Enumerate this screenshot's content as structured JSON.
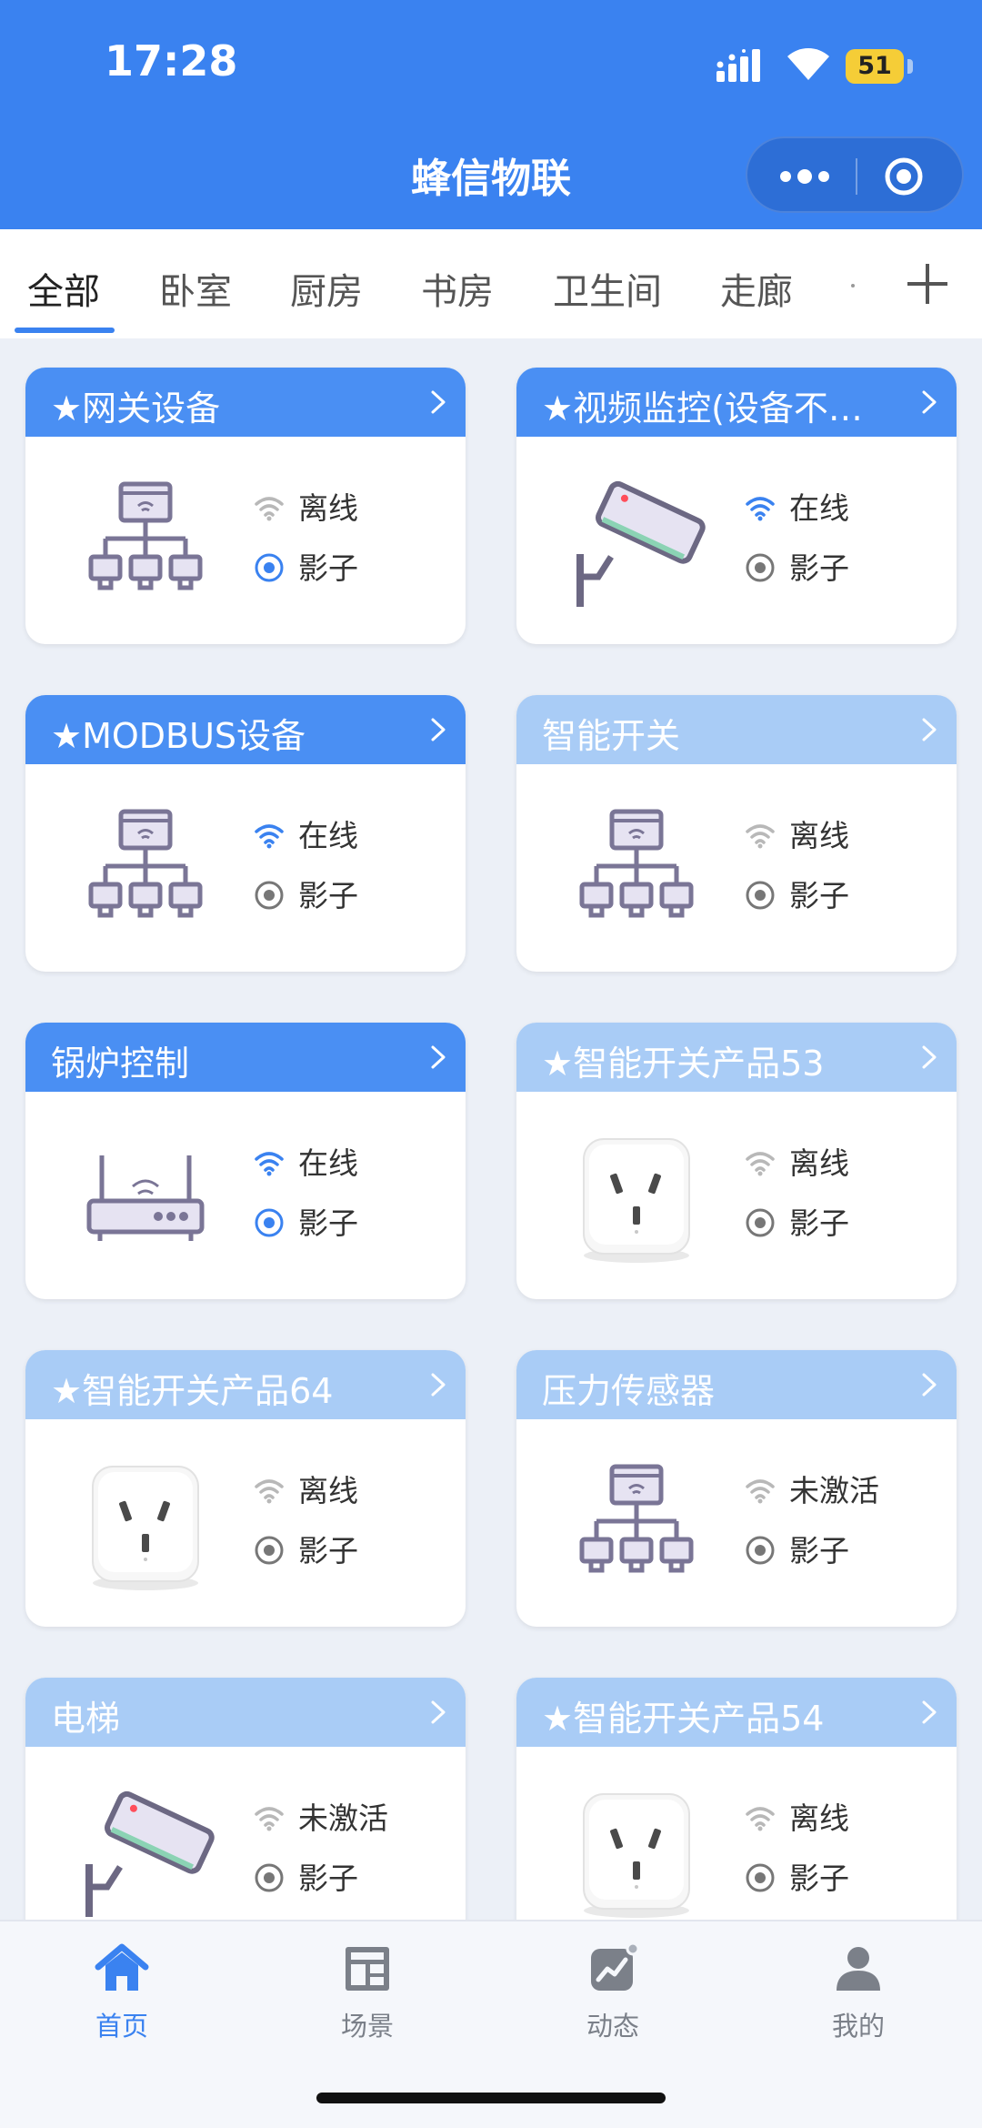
{
  "status_bar": {
    "time": "17:28",
    "battery": "51"
  },
  "app": {
    "title": "蜂信物联"
  },
  "tabs": [
    "全部",
    "卧室",
    "厨房",
    "书房",
    "卫生间",
    "走廊"
  ],
  "devices": [
    {
      "title": "★网关设备",
      "status": "离线",
      "shadow": "影子",
      "image": "gateway-icon"
    },
    {
      "title": "★视频监控(设备不…",
      "status": "在线",
      "shadow": "影子",
      "image": "camera-icon"
    },
    {
      "title": "★MODBUS设备",
      "status": "在线",
      "shadow": "影子",
      "image": "gateway-icon"
    },
    {
      "title": "智能开关",
      "status": "离线",
      "shadow": "影子",
      "image": "gateway-icon"
    },
    {
      "title": "锅炉控制",
      "status": "在线",
      "shadow": "影子",
      "image": "router-icon"
    },
    {
      "title": "★智能开关产品53",
      "status": "离线",
      "shadow": "影子",
      "image": "smart-plug-icon"
    },
    {
      "title": "★智能开关产品64",
      "status": "离线",
      "shadow": "影子",
      "image": "smart-plug-icon"
    },
    {
      "title": "压力传感器",
      "status": "未激活",
      "shadow": "影子",
      "image": "gateway-icon"
    },
    {
      "title": "电梯",
      "status": "未激活",
      "shadow": "影子",
      "image": "camera-icon"
    },
    {
      "title": "★智能开关产品54",
      "status": "离线",
      "shadow": "影子",
      "image": "smart-plug-icon"
    }
  ],
  "nav": [
    {
      "label": "首页",
      "icon": "home-icon",
      "active": true
    },
    {
      "label": "场景",
      "icon": "scene-icon"
    },
    {
      "label": "动态",
      "icon": "activity-icon"
    },
    {
      "label": "我的",
      "icon": "profile-icon"
    }
  ],
  "colors": {
    "primary": "#3a82f0",
    "card_header": "#4a8ff3",
    "card_header_dim": "#a9ccf6",
    "online": "#3a82f0",
    "offline": "#b8b8b8"
  }
}
